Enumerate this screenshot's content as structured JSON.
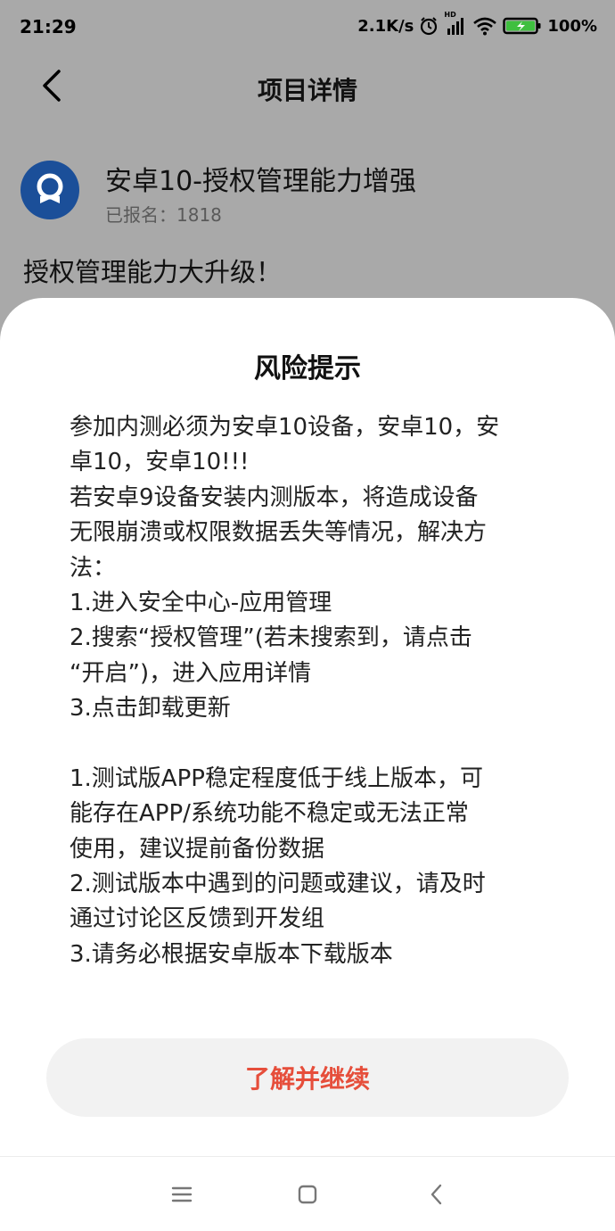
{
  "status_bar": {
    "time": "21:29",
    "network_speed": "2.1K/s",
    "hd_label": "HD",
    "battery": "100%",
    "icons": [
      "alarm-icon",
      "signal-icon",
      "wifi-icon",
      "battery-icon"
    ]
  },
  "header": {
    "title": "项目详情",
    "back_icon": "chevron-left-icon"
  },
  "project": {
    "name": "安卓10-授权管理能力增强",
    "signup_count": "已报名：1818",
    "description": "授权管理能力大升级！"
  },
  "dialog": {
    "title": "风险提示",
    "lines": [
      "参加内测必须为安卓10设备，安卓10，安",
      "卓10，安卓10!!!",
      "若安卓9设备安装内测版本，将造成设备",
      "无限崩溃或权限数据丢失等情况，解决方",
      "法：",
      "1.进入安全中心-应用管理",
      "2.搜索“授权管理”(若未搜索到，请点击",
      "“开启”)，进入应用详情",
      "3.点击卸载更新",
      "",
      "1.测试版APP稳定程度低于线上版本，可",
      "能存在APP/系统功能不稳定或无法正常",
      "使用，建议提前备份数据",
      "2.测试版本中遇到的问题或建议，请及时",
      "通过讨论区反馈到开发组",
      "3.请务必根据安卓版本下载版本"
    ],
    "button_label": "了解并继续",
    "button_color": "#e64e3b"
  },
  "navbar": {
    "items": [
      "menu-icon",
      "home-icon",
      "back-icon"
    ]
  },
  "colors": {
    "dim_background": "#a9a9a9",
    "avatar": "#1b4f99",
    "battery_fill": "#3fbf3f"
  }
}
